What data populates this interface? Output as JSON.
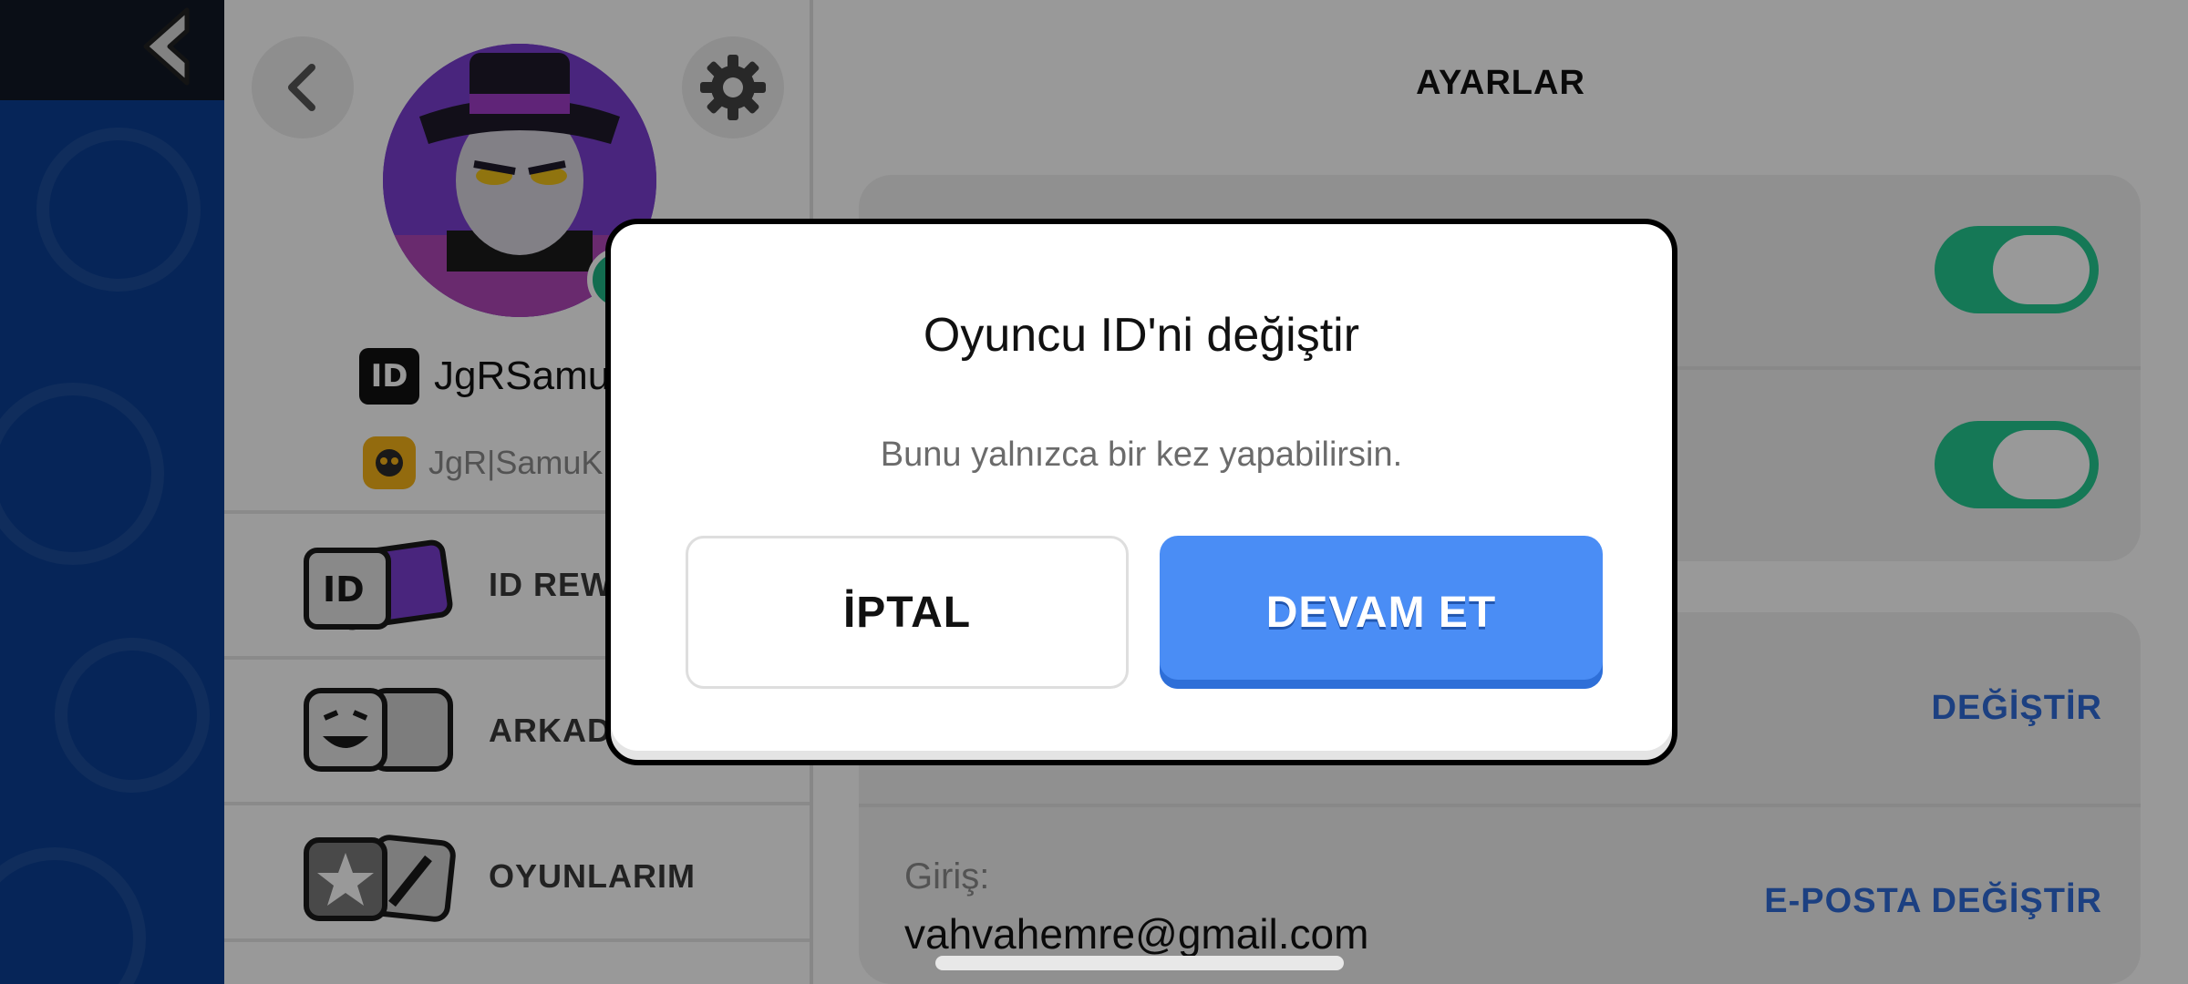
{
  "profile": {
    "player_name": "JgRSamu",
    "id_badge": "ID",
    "club_name": "JgR|SamuK"
  },
  "menu": [
    {
      "label": "ID REW",
      "icon": "id-card-icon"
    },
    {
      "label": "ARKAD",
      "icon": "friends-icon"
    },
    {
      "label": "OYUNLARIM",
      "icon": "my-games-icon"
    }
  ],
  "settings": {
    "title": "AYARLAR",
    "change_label": "DEĞİŞTİR",
    "login_label": "Giriş:",
    "login_email": "vahvahemre@gmail.com",
    "change_email_label": "E-POSTA DEĞİŞTİR",
    "toggles": [
      true,
      true
    ]
  },
  "dialog": {
    "title": "Oyuncu ID'ni değiştir",
    "subtitle": "Bunu yalnızca bir kez yapabilirsin.",
    "cancel_label": "İPTAL",
    "continue_label": "DEVAM ET"
  },
  "colors": {
    "accent_blue": "#4a8df5",
    "toggle_green": "#23c890",
    "link_blue": "#2f6bd8",
    "game_bg": "#0b3f93"
  }
}
